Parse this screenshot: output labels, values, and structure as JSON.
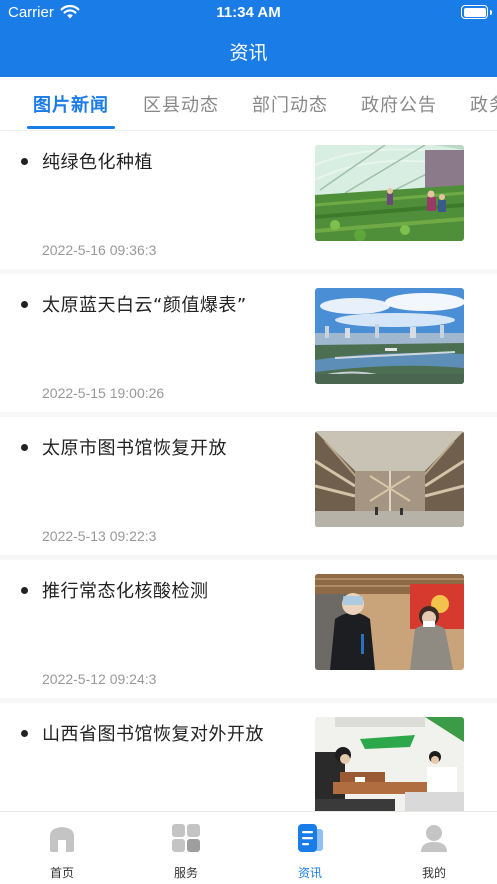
{
  "status_bar": {
    "carrier": "Carrier",
    "time": "11:34 AM"
  },
  "header": {
    "title": "资讯"
  },
  "tabs": [
    {
      "label": "图片新闻",
      "active": true
    },
    {
      "label": "区县动态",
      "active": false
    },
    {
      "label": "部门动态",
      "active": false
    },
    {
      "label": "政府公告",
      "active": false
    },
    {
      "label": "政务",
      "active": false
    }
  ],
  "news": [
    {
      "title": "纯绿色化种植",
      "date": "2022-5-16 09:36:3",
      "image": "greenhouse-planting-photo"
    },
    {
      "title": "太原蓝天白云“颜值爆表”",
      "date": "2022-5-15 19:00:26",
      "image": "city-skyline-river-photo"
    },
    {
      "title": "太原市图书馆恢复开放",
      "date": "2022-5-13 09:22:3",
      "image": "library-atrium-photo"
    },
    {
      "title": "推行常态化核酸检测",
      "date": "2022-5-12 09:24:3",
      "image": "nucleic-acid-testing-photo"
    },
    {
      "title": "山西省图书馆恢复对外开放",
      "date": "",
      "image": "library-reading-room-photo"
    }
  ],
  "tabbar": [
    {
      "label": "首页",
      "icon": "home-icon",
      "active": false
    },
    {
      "label": "服务",
      "icon": "grid-icon",
      "active": false
    },
    {
      "label": "资讯",
      "icon": "document-icon",
      "active": true
    },
    {
      "label": "我的",
      "icon": "user-icon",
      "active": false
    }
  ],
  "colors": {
    "primary": "#1a7ce6",
    "inactive_tab": "#888888",
    "date_text": "#999999"
  }
}
